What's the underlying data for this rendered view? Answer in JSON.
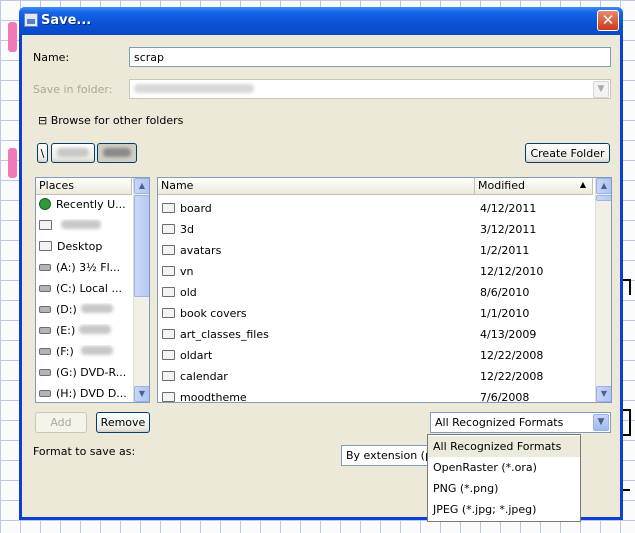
{
  "window": {
    "title": "Save..."
  },
  "form": {
    "name_label": "Name:",
    "name_value": "scrap",
    "save_in_label": "Save in folder:",
    "browse_label": "Browse for other folders",
    "browse_toggle": "⊟",
    "path_root": "\\",
    "create_folder_label": "Create Folder"
  },
  "places": {
    "header": "Places",
    "items": [
      {
        "icon": "recent-icon",
        "label": "Recently U..."
      },
      {
        "icon": "folder-icon",
        "label": ""
      },
      {
        "icon": "folder-icon",
        "label": "Desktop"
      },
      {
        "icon": "floppy-icon",
        "label": "(A:) 3½ Fl..."
      },
      {
        "icon": "drive-icon",
        "label": "(C:) Local ..."
      },
      {
        "icon": "drive-icon",
        "label": "(D:)"
      },
      {
        "icon": "drive-icon",
        "label": "(E:)"
      },
      {
        "icon": "drive-icon",
        "label": "(F:) "
      },
      {
        "icon": "cdrom-icon",
        "label": "(G:) DVD-R..."
      },
      {
        "icon": "cdrom-icon",
        "label": "(H:) DVD D..."
      }
    ],
    "add_label": "Add",
    "remove_label": "Remove"
  },
  "files": {
    "col_name": "Name",
    "col_modified": "Modified",
    "sort_indicator": "▲",
    "rows": [
      {
        "name": "board",
        "modified": "4/12/2011"
      },
      {
        "name": "3d",
        "modified": "3/12/2011"
      },
      {
        "name": "avatars",
        "modified": "1/2/2011"
      },
      {
        "name": "vn",
        "modified": "12/12/2010"
      },
      {
        "name": "old",
        "modified": "8/6/2010"
      },
      {
        "name": "book covers",
        "modified": "1/1/2010"
      },
      {
        "name": "art_classes_files",
        "modified": "4/13/2009"
      },
      {
        "name": "oldart",
        "modified": "12/22/2008"
      },
      {
        "name": "calendar",
        "modified": "12/22/2008"
      },
      {
        "name": "moodtheme",
        "modified": "7/6/2008"
      }
    ]
  },
  "format": {
    "label": "Format to save as:",
    "by_extension_value": "By extension (p",
    "filter_selected": "All Recognized Formats",
    "filter_options": [
      "All Recognized Formats",
      "OpenRaster (*.ora)",
      "PNG (*.png)",
      "JPEG (*.jpg; *.jpeg)"
    ]
  }
}
